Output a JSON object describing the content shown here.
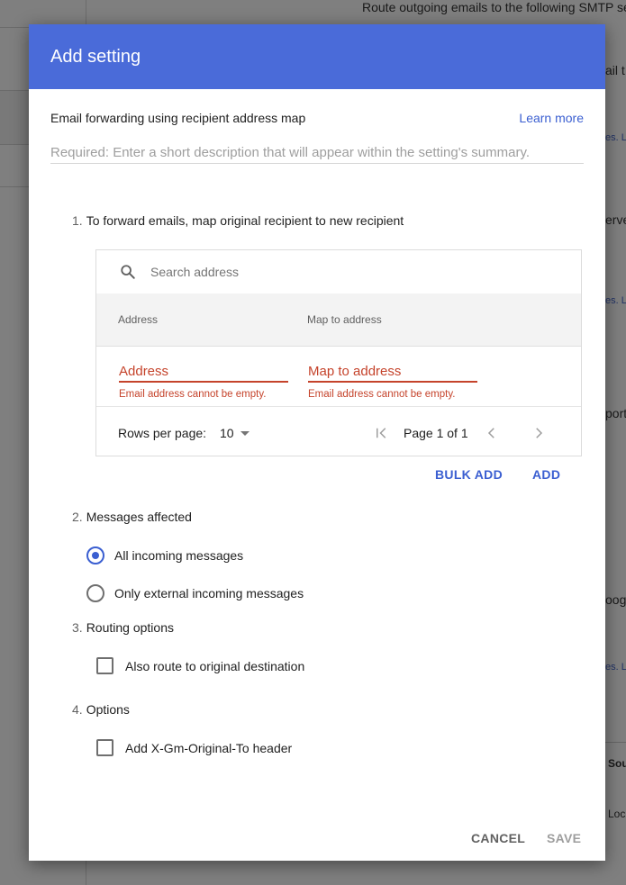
{
  "background": {
    "top_text": "Route outgoing emails to the following SMTP se",
    "frag_1": "ail t",
    "frag_2": "es. L",
    "frag_3": "erve",
    "frag_4": "es. L",
    "frag_5": "port",
    "frag_6": "oogl",
    "frag_7": "es. L",
    "frag_8": "Sou",
    "frag_9": "Loc"
  },
  "dialog": {
    "title": "Add setting",
    "setting_name": "Email forwarding using recipient address map",
    "learn_more": "Learn more",
    "description_placeholder": "Required: Enter a short description that will appear within the setting's summary."
  },
  "section1": {
    "number": "1.",
    "title": "To forward emails, map original recipient to new recipient",
    "search_placeholder": "Search address",
    "columns": [
      "Address",
      "Map to address"
    ],
    "address_placeholder": "Address",
    "map_placeholder": "Map to address",
    "address_error": "Email address cannot be empty.",
    "map_error": "Email address cannot be empty.",
    "rows_per_page_label": "Rows per page:",
    "rows_per_page_value": "10",
    "page_label": "Page 1 of 1",
    "bulk_add": "BULK ADD",
    "add": "ADD"
  },
  "section2": {
    "number": "2.",
    "title": "Messages affected",
    "options": [
      "All incoming messages",
      "Only external incoming messages"
    ],
    "selected_index": 0
  },
  "section3": {
    "number": "3.",
    "title": "Routing options",
    "checkbox_label": "Also route to original destination",
    "checked": false
  },
  "section4": {
    "number": "4.",
    "title": "Options",
    "checkbox_label": "Add X-Gm-Original-To header",
    "checked": false
  },
  "footer": {
    "cancel": "CANCEL",
    "save": "SAVE"
  },
  "colors": {
    "header": "#4a6bd9",
    "accent": "#3b5fd1",
    "error": "#c5432b",
    "disabled": "#9e9e9e"
  }
}
